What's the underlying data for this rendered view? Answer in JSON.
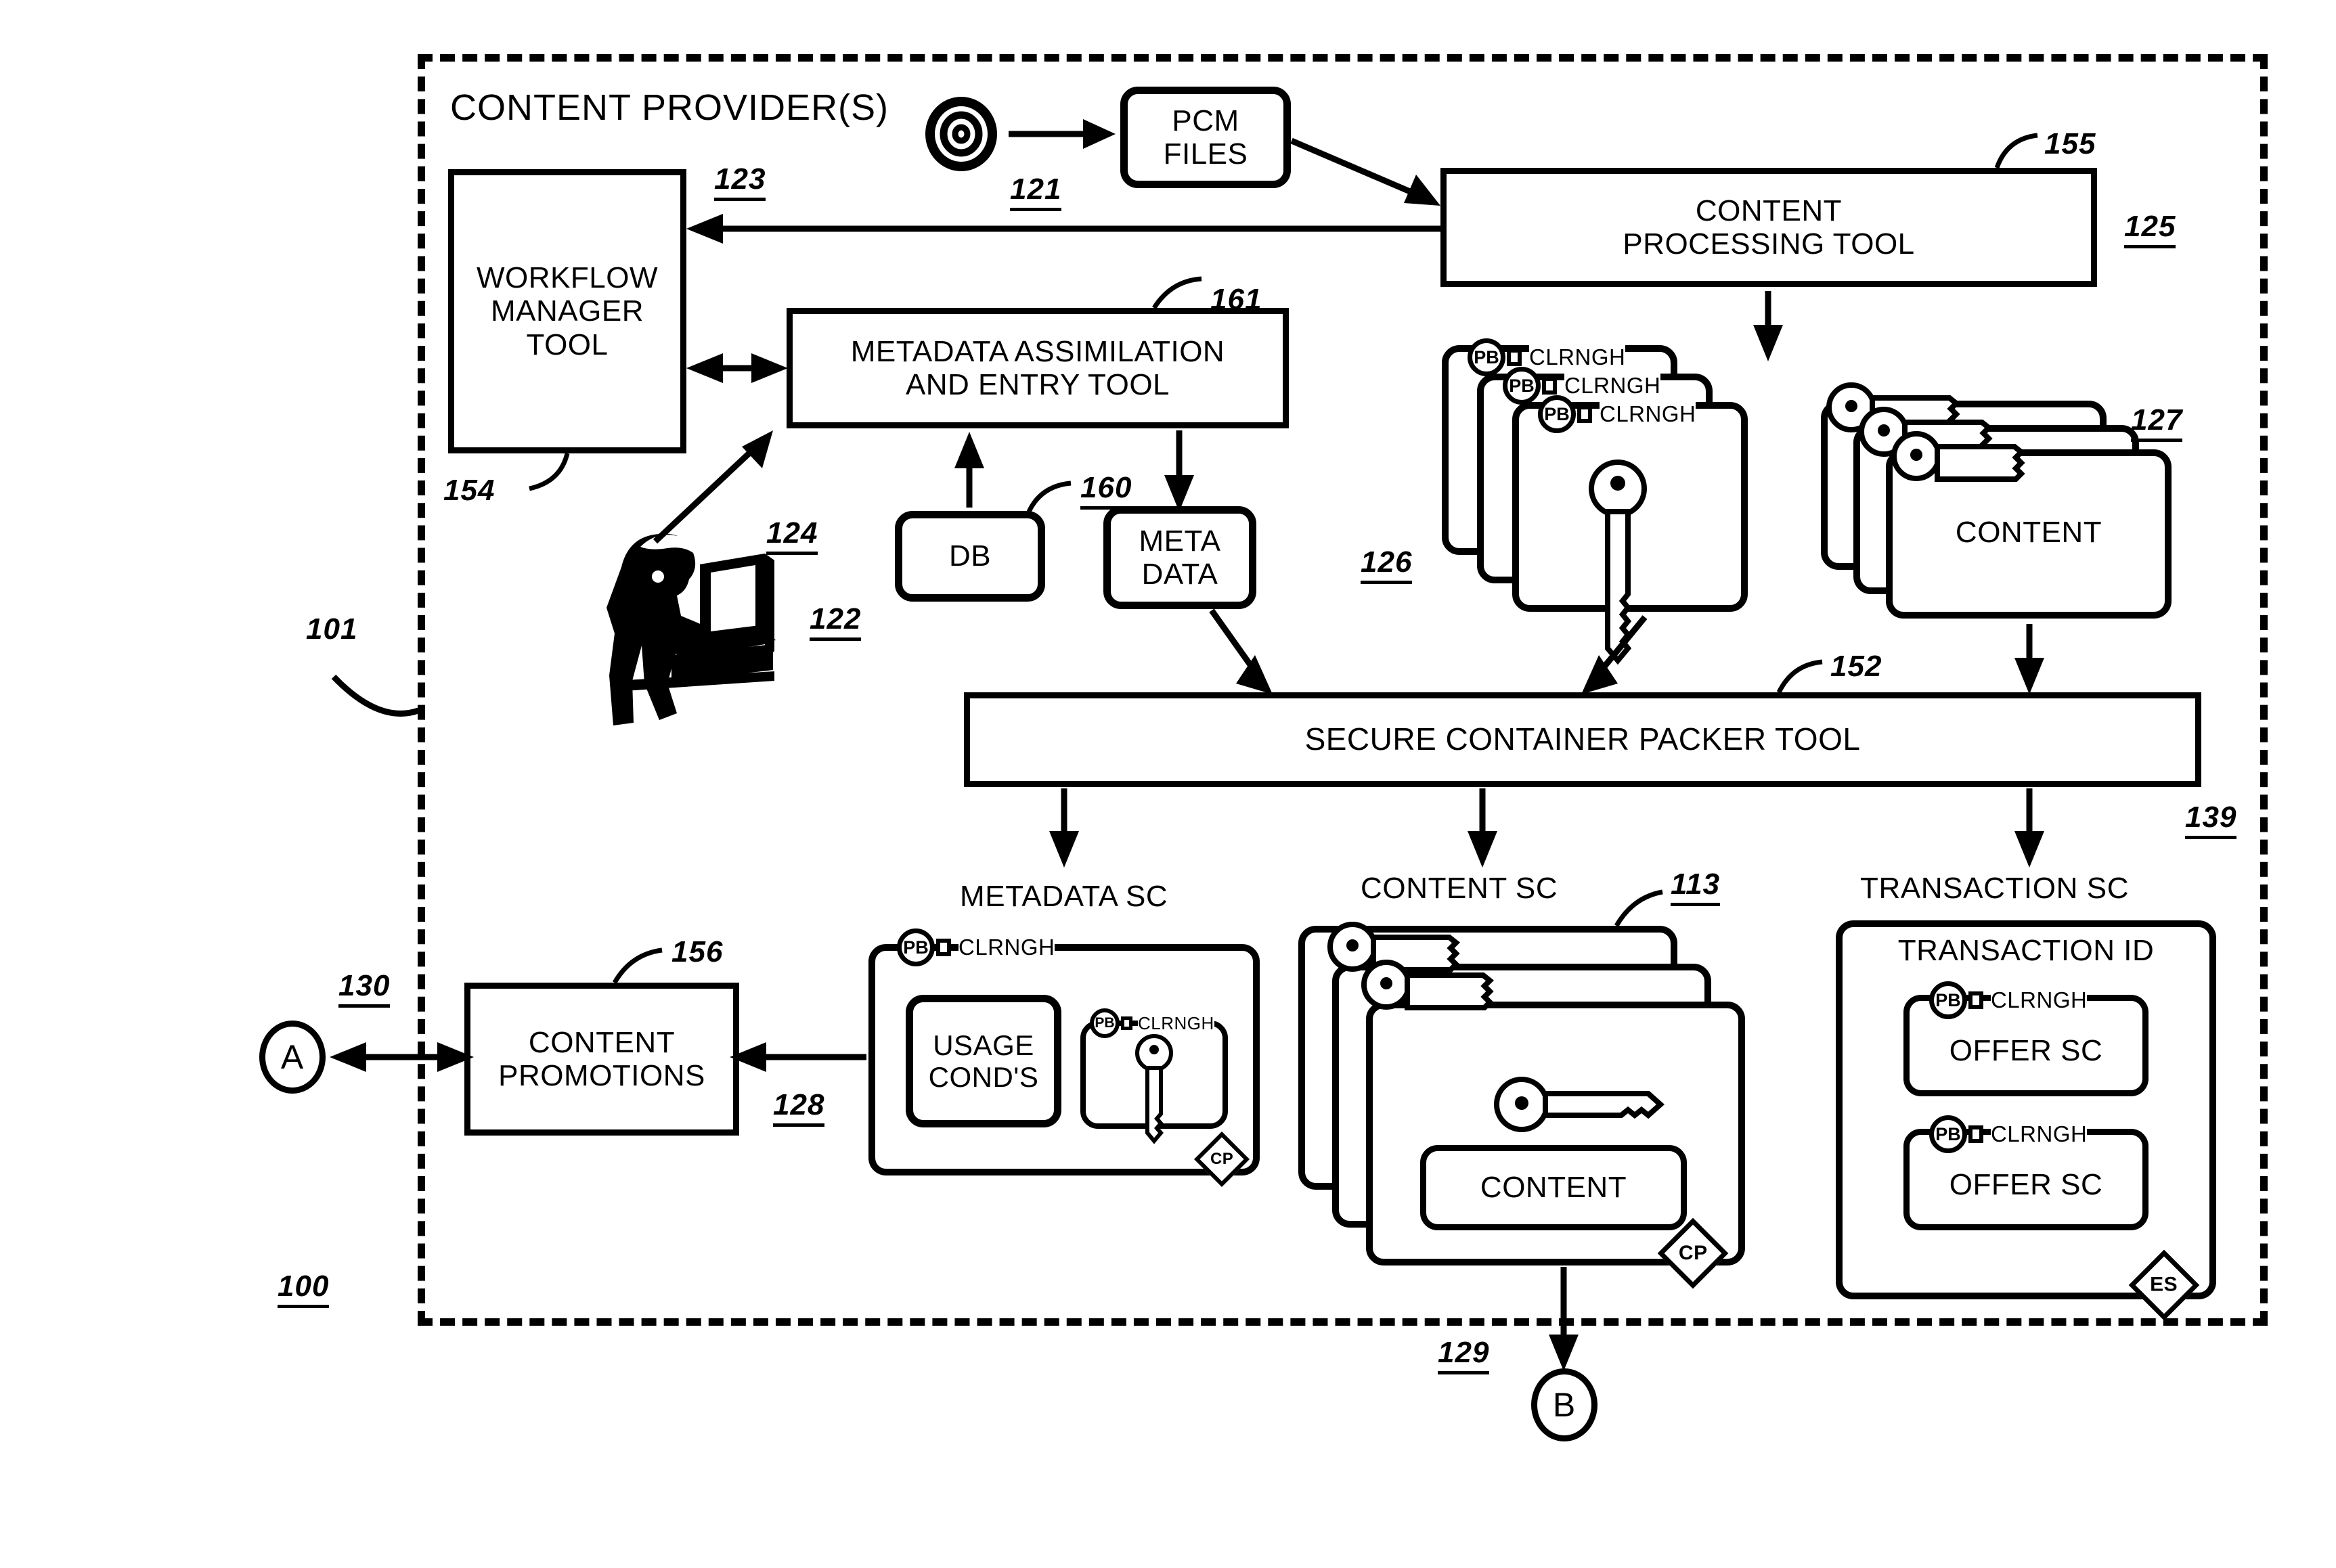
{
  "figure": {
    "outer_boundary_label": "100",
    "boundary_pointer_label": "101",
    "container_title": "CONTENT PROVIDER(S)"
  },
  "blocks": {
    "workflow_manager": {
      "label": "WORKFLOW\nMANAGER\nTOOL",
      "ref_top": "123",
      "ref_bottom": "154"
    },
    "metadata_tool": {
      "label": "METADATA ASSIMILATION\nAND ENTRY TOOL",
      "ref": "161"
    },
    "content_processing": {
      "label": "CONTENT\nPROCESSING TOOL",
      "ref_top": "155",
      "ref_side": "125"
    },
    "pcm_files": {
      "label": "PCM\nFILES"
    },
    "disc_source": {
      "ref": "121",
      "icon": "optical-disc-icon"
    },
    "operator": {
      "ref": "124",
      "icon": "person-at-computer-icon"
    },
    "db": {
      "label": "DB",
      "ref_top": "160",
      "ref_bottom": "122"
    },
    "meta_data": {
      "label": "META\nDATA"
    },
    "packer": {
      "label": "SECURE CONTAINER PACKER TOOL",
      "ref": "152"
    },
    "content_promotions": {
      "label": "CONTENT\nPROMOTIONS",
      "ref_top": "156",
      "ref_bottom": "128"
    }
  },
  "key_stack": {
    "ref": "126",
    "badge_pb": "PB",
    "badge_text": "CLRNGH",
    "card_count": 3,
    "icon": "vertical-key-icon"
  },
  "content_stack": {
    "ref": "127",
    "label": "CONTENT",
    "card_count": 3,
    "icon": "horizontal-key-icon"
  },
  "secure_containers": {
    "metadata_sc": {
      "title": "METADATA SC",
      "badge_pb": "PB",
      "badge_text": "CLRNGH",
      "usage_box_label": "USAGE\nCOND'S",
      "inner_badge_pb": "PB",
      "inner_badge_text": "CLRNGH",
      "inner_icon": "vertical-key-icon",
      "seal": "CP"
    },
    "content_sc": {
      "title": "CONTENT SC",
      "ref": "113",
      "card_count": 3,
      "icon": "horizontal-key-icon",
      "inner_label": "CONTENT",
      "seal": "CP"
    },
    "transaction_sc": {
      "title": "TRANSACTION SC",
      "ref": "139",
      "heading": "TRANSACTION ID",
      "offers": [
        {
          "badge_pb": "PB",
          "badge_text": "CLRNGH",
          "label": "OFFER SC"
        },
        {
          "badge_pb": "PB",
          "badge_text": "CLRNGH",
          "label": "OFFER SC"
        }
      ],
      "seal": "ES"
    }
  },
  "connectors": {
    "a": {
      "letter": "A",
      "ref": "130"
    },
    "b": {
      "letter": "B",
      "ref": "129"
    }
  }
}
